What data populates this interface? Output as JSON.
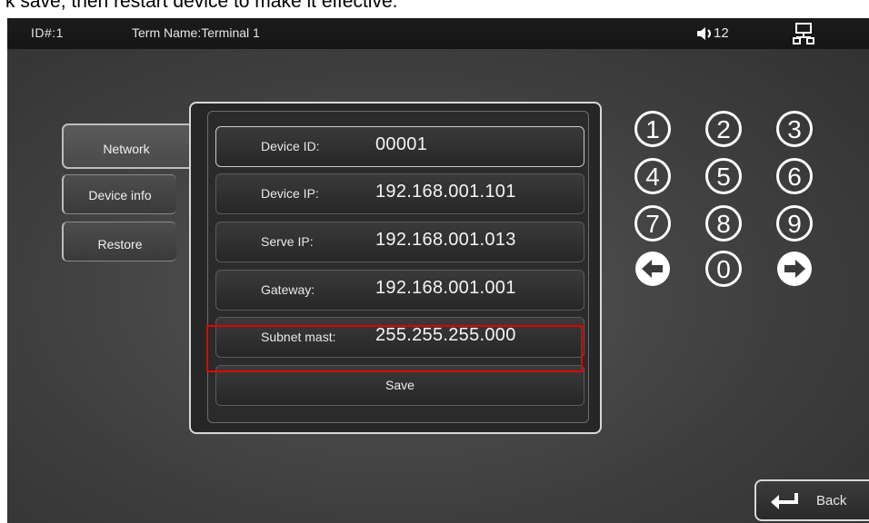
{
  "instruction_text": "k save, then restart device to make it effective.",
  "topbar": {
    "device_id": "ID#:1",
    "terminal_name": "Term Name:Terminal 1",
    "volume": "12",
    "volume_icon": "speaker-icon",
    "network_icon": "network-icon"
  },
  "tabs": [
    {
      "label": "Network",
      "active": true
    },
    {
      "label": "Device info",
      "active": false
    },
    {
      "label": "Restore",
      "active": false
    }
  ],
  "form": {
    "rows": [
      {
        "label": "Device ID:",
        "value": "00001"
      },
      {
        "label": "Device IP:",
        "value": "192.168.001.101"
      },
      {
        "label": "Serve IP:",
        "value": "192.168.001.013"
      },
      {
        "label": "Gateway:",
        "value": "192.168.001.001"
      },
      {
        "label": "Subnet mast:",
        "value": "255.255.255.000"
      }
    ],
    "save_label": "Save"
  },
  "keypad": {
    "keys": [
      "1",
      "2",
      "3",
      "4",
      "5",
      "6",
      "7",
      "8",
      "9",
      "left-arrow-icon",
      "0",
      "right-arrow-icon"
    ]
  },
  "back": {
    "label": "Back",
    "icon": "return-icon"
  },
  "colors": {
    "highlight": "#e00000"
  }
}
